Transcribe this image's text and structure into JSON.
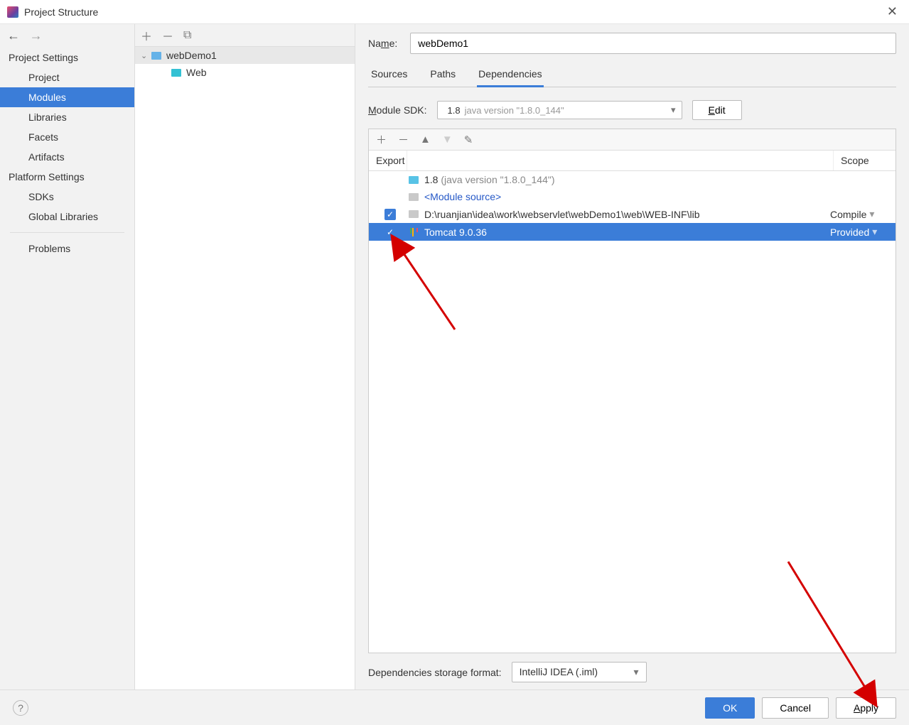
{
  "window": {
    "title": "Project Structure"
  },
  "nav": {
    "section1_title": "Project Settings",
    "section1_items": [
      "Project",
      "Modules",
      "Libraries",
      "Facets",
      "Artifacts"
    ],
    "selected": "Modules",
    "section2_title": "Platform Settings",
    "section2_items": [
      "SDKs",
      "Global Libraries"
    ],
    "problems": "Problems"
  },
  "tree": {
    "root": "webDemo1",
    "child": "Web"
  },
  "right": {
    "name_label": "Name:",
    "name_value": "webDemo1",
    "tabs": [
      "Sources",
      "Paths",
      "Dependencies"
    ],
    "active_tab": "Dependencies",
    "sdk": {
      "label": "Module SDK:",
      "version": "1.8",
      "desc": "java version \"1.8.0_144\"",
      "edit_label": "Edit"
    },
    "dep_header": {
      "export": "Export",
      "scope": "Scope"
    },
    "deps": [
      {
        "export": false,
        "checkable": false,
        "icon": "sdk",
        "name": "1.8",
        "note": "(java version \"1.8.0_144\")",
        "scope": "",
        "style": "grey"
      },
      {
        "export": false,
        "checkable": false,
        "icon": "folder-grey",
        "name": "<Module source>",
        "note": "",
        "scope": "",
        "style": "link"
      },
      {
        "export": true,
        "checkable": true,
        "icon": "folder-grey",
        "name": "D:\\ruanjian\\idea\\work\\webservlet\\webDemo1\\web\\WEB-INF\\lib",
        "note": "",
        "scope": "Compile",
        "style": ""
      },
      {
        "export": true,
        "checkable": true,
        "icon": "lib",
        "name": "Tomcat 9.0.36",
        "note": "",
        "scope": "Provided",
        "style": "",
        "selected": true
      }
    ],
    "storage": {
      "label": "Dependencies storage format:",
      "value": "IntelliJ IDEA (.iml)"
    }
  },
  "footer": {
    "ok": "OK",
    "cancel": "Cancel",
    "apply": "Apply"
  }
}
